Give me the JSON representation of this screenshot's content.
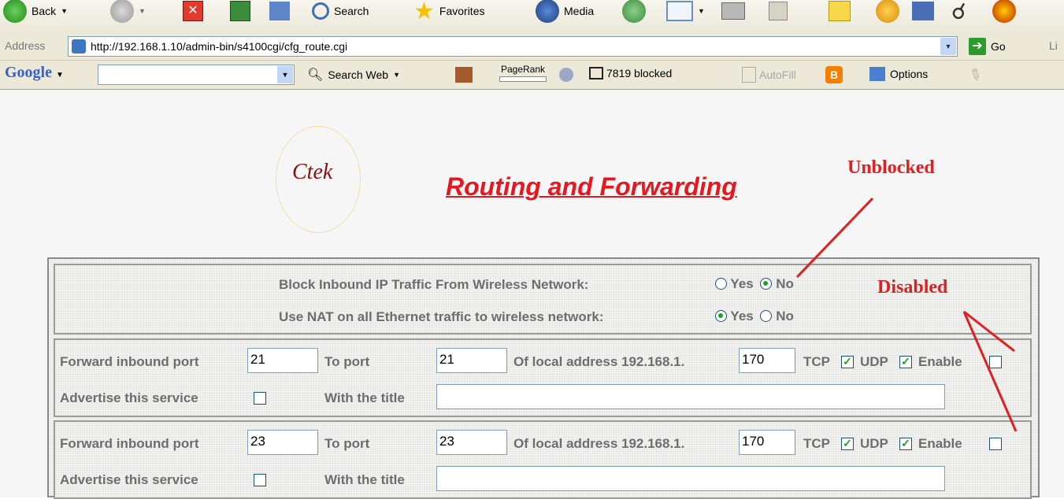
{
  "toolbar": {
    "back_label": "Back",
    "search_label": "Search",
    "favorites_label": "Favorites",
    "media_label": "Media"
  },
  "address_bar": {
    "label": "Address",
    "url": "http://192.168.1.10/admin-bin/s4100cgi/cfg_route.cgi",
    "go_label": "Go",
    "links_label": "Li"
  },
  "google_bar": {
    "logo": "Google",
    "search_web_label": "Search Web",
    "pagerank_label": "PageRank",
    "blocked_label": "7819 blocked",
    "autofill_label": "AutoFill",
    "options_label": "Options"
  },
  "page": {
    "logo_text": "Ctek",
    "title": "Routing and Forwarding",
    "block_inbound_label": "Block Inbound IP Traffic From Wireless Network:",
    "block_inbound_value": "No",
    "nat_label": "Use NAT on all Ethernet traffic to wireless network:",
    "nat_value": "Yes",
    "yes_label": "Yes",
    "no_label": "No",
    "forward_rules": [
      {
        "forward_label": "Forward inbound port",
        "inbound_port": "21",
        "to_port_label": "To port",
        "to_port": "21",
        "local_addr_label": "Of local address 192.168.1.",
        "local_addr": "170",
        "tcp_label": "TCP",
        "tcp": true,
        "udp_label": "UDP",
        "udp": true,
        "enable_label": "Enable",
        "enable": false,
        "advertise_label": "Advertise this service",
        "advertise": false,
        "title_label": "With the title",
        "title_value": ""
      },
      {
        "forward_label": "Forward inbound port",
        "inbound_port": "23",
        "to_port_label": "To port",
        "to_port": "23",
        "local_addr_label": "Of local address 192.168.1.",
        "local_addr": "170",
        "tcp_label": "TCP",
        "tcp": true,
        "udp_label": "UDP",
        "udp": true,
        "enable_label": "Enable",
        "enable": false,
        "advertise_label": "Advertise this service",
        "advertise": false,
        "title_label": "With the title",
        "title_value": ""
      }
    ]
  },
  "annotations": {
    "unblocked": "Unblocked",
    "disabled": "Disabled"
  },
  "colors": {
    "title_red": "#e8161e",
    "annotation_red": "#e02020",
    "label_gray": "#6d6d70",
    "check_green": "#21a121"
  }
}
